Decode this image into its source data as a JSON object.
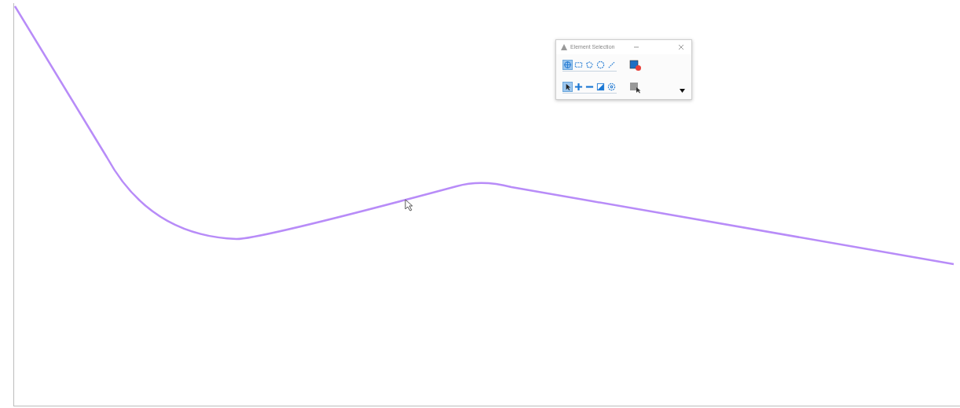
{
  "palette": {
    "title": "Element Selection",
    "methods": [
      {
        "kind": "individual",
        "selected": true
      },
      {
        "kind": "block",
        "selected": false
      },
      {
        "kind": "shape",
        "selected": false
      },
      {
        "kind": "circle",
        "selected": false
      },
      {
        "kind": "line",
        "selected": false
      }
    ],
    "modes": [
      {
        "kind": "pointer",
        "selected": true
      },
      {
        "kind": "add",
        "selected": false
      },
      {
        "kind": "subtract",
        "selected": false
      },
      {
        "kind": "invert",
        "selected": false
      },
      {
        "kind": "all",
        "selected": false
      }
    ]
  }
}
